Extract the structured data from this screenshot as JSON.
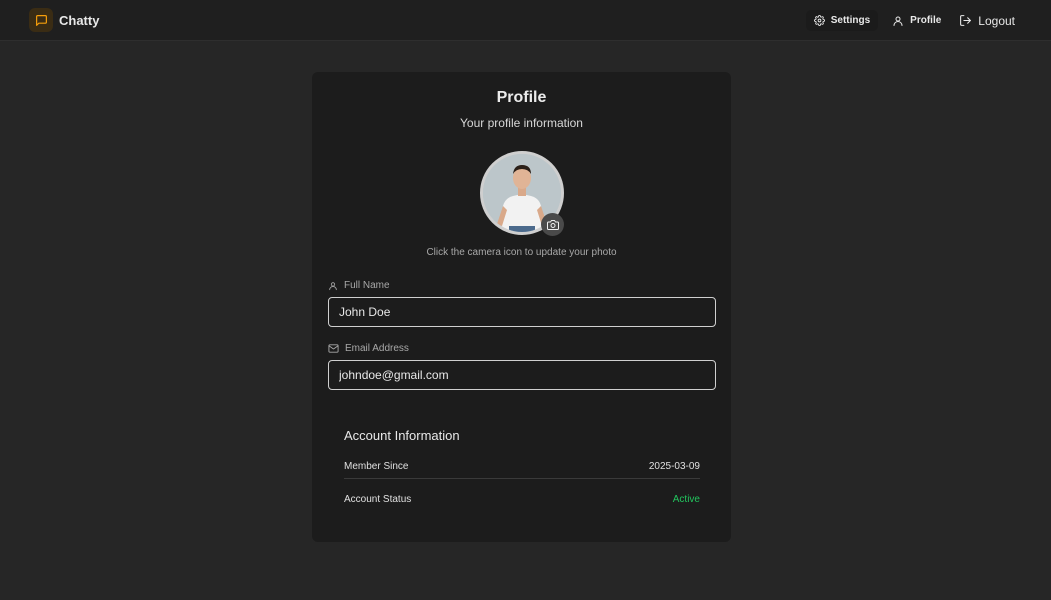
{
  "app": {
    "name": "Chatty"
  },
  "nav": {
    "settings_label": "Settings",
    "profile_label": "Profile",
    "logout_label": "Logout"
  },
  "profile": {
    "title": "Profile",
    "subtitle": "Your profile information",
    "avatar_hint": "Click the camera icon to update your photo"
  },
  "fields": {
    "full_name": {
      "label": "Full Name",
      "value": "John Doe"
    },
    "email": {
      "label": "Email Address",
      "value": "johndoe@gmail.com"
    }
  },
  "account": {
    "title": "Account Information",
    "member_since_label": "Member Since",
    "member_since_value": "2025-03-09",
    "status_label": "Account Status",
    "status_value": "Active"
  },
  "colors": {
    "accent": "#f59e0b",
    "status_active": "#22c55e",
    "background": "#262626",
    "card": "#1c1c1c"
  },
  "icons": [
    "chat-bubble-icon",
    "gear-icon",
    "user-icon",
    "logout-icon",
    "camera-icon",
    "mail-icon"
  ]
}
